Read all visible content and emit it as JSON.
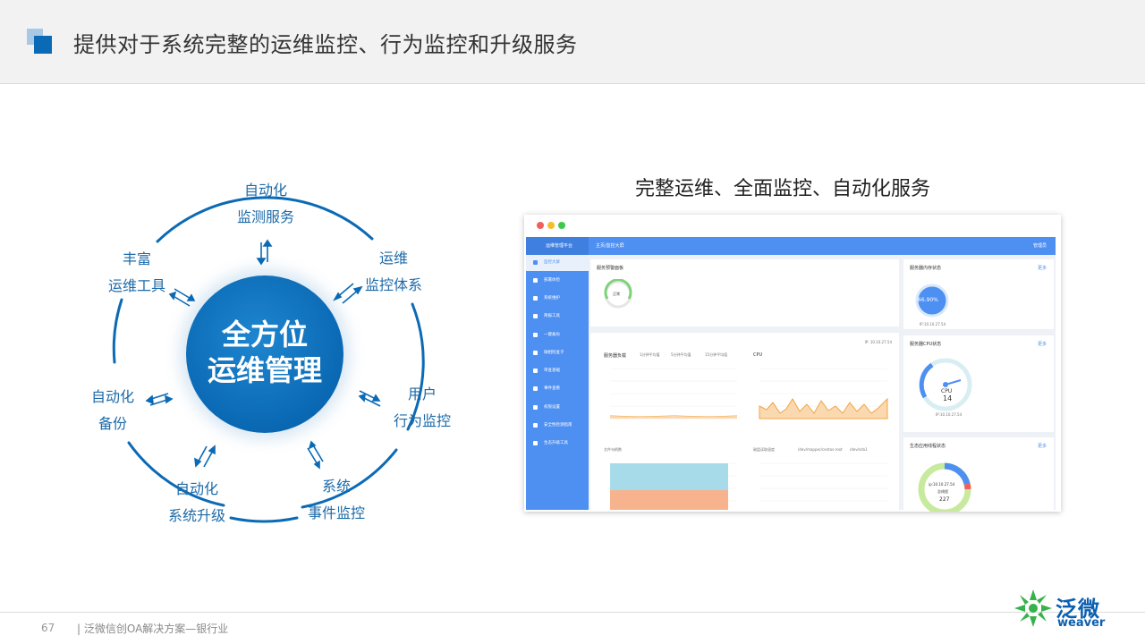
{
  "header": {
    "title": "提供对于系统完整的运维监控、行为监控和升级服务"
  },
  "diagram": {
    "center_line1": "全方位",
    "center_line2": "运维管理",
    "nodes": {
      "top": [
        "自动化",
        "监测服务"
      ],
      "top_right": [
        "运维",
        "监控体系"
      ],
      "right": [
        "用户",
        "行为监控"
      ],
      "bottom_right": [
        "系统",
        "事件监控"
      ],
      "bottom_left": [
        "自动化",
        "系统升级"
      ],
      "left": [
        "自动化",
        "备份"
      ],
      "top_left": [
        "丰富",
        "运维工具"
      ]
    }
  },
  "screenshot": {
    "subtitle": "完整运维、全面监控、自动化服务",
    "app_name": "运维管理平台",
    "breadcrumb": "主页/监控大屏",
    "user": "管理员",
    "sidebar_items": [
      "监控大屏",
      "部署体检",
      "系统维护",
      "简报工具",
      "一键备份",
      "微相检查子",
      "审查基础",
      "事件查看",
      "权限设置",
      "安全性检测指南",
      "生态升级工具"
    ],
    "cards": {
      "alarm": "服务预警面板",
      "alarm_status": "正常",
      "memory": "服务器内存状态",
      "memory_value": "66.90%",
      "memory_ip": "IP:10.10.27.54",
      "load": "服务器负载",
      "cpu_chart": "CPU",
      "cpu_status": "服务器CPU状态",
      "cpu_label": "CPU",
      "cpu_value": "14",
      "cpu_ip": "IP:10.10.27.54",
      "file_handles": "文件句柄数",
      "disk_read": "磁盘读取速度",
      "thread_status": "生态应用线程状态",
      "thread_ip": "ip:10.10.27.54",
      "thread_total_label": "总线程",
      "thread_value": "227",
      "more": "更多",
      "legend": [
        "1分钟平均值",
        "5分钟平均值",
        "15分钟平均值"
      ],
      "disk_legend": [
        "/dev/mapper/centos-root",
        "/dev/sda1"
      ],
      "ip_top": "IP: 10.10.27.54"
    },
    "colors": {
      "accent": "#4e8ff2",
      "green": "#7ed37a",
      "orange": "#f0a445",
      "cyan": "#a8dbea"
    }
  },
  "footer": {
    "page_number": "67",
    "text": "| 泛微信创OA解决方案—银行业",
    "brand_cn": "泛微",
    "brand_en": "weaver"
  }
}
